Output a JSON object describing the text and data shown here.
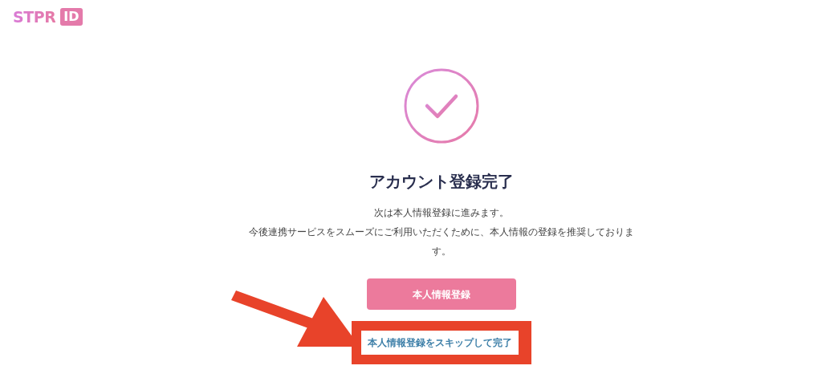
{
  "logo": {
    "text": "STPR",
    "badge": "ID"
  },
  "title": "アカウント登録完了",
  "message": [
    "次は本人情報登録に進みます。",
    "今後連携サービスをスムーズにご利用いただくために、本人情報の登録を推奨しております。"
  ],
  "primary_button": "本人情報登録",
  "skip_link": {
    "label": "本人情報登録をスキップして完了",
    "highlighted": true
  }
}
